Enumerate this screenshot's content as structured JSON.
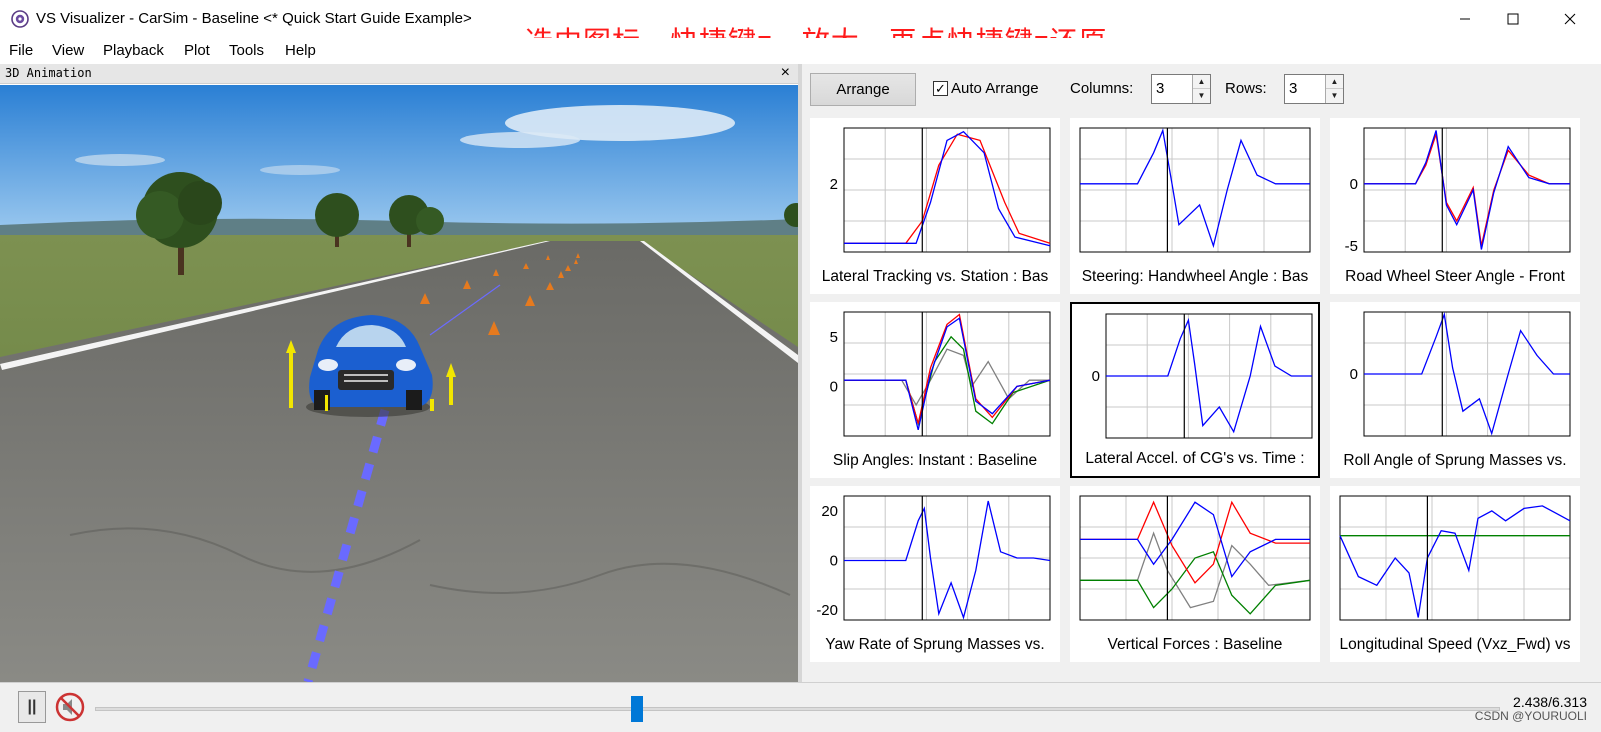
{
  "window": {
    "title": "VS Visualizer - CarSim - Baseline <* Quick Start Guide Example>",
    "annotation": "选中图标，快捷键z，放大，再点快捷键z还原"
  },
  "menu": [
    "File",
    "View",
    "Playback",
    "Plot",
    "Tools",
    "Help"
  ],
  "animation": {
    "title": "3D Animation"
  },
  "toolbar": {
    "arrange_label": "Arrange",
    "auto_arrange_label": "Auto Arrange",
    "auto_arrange_checked": true,
    "columns_label": "Columns:",
    "columns_value": "3",
    "rows_label": "Rows:",
    "rows_value": "3"
  },
  "plots": [
    {
      "title": "Lateral Tracking vs. Station : Bas",
      "yticks": [
        "2"
      ],
      "selected": false
    },
    {
      "title": "Steering: Handwheel Angle : Bas",
      "yticks": [],
      "selected": false
    },
    {
      "title": "Road Wheel Steer Angle - Front",
      "yticks": [
        "0",
        "-5"
      ],
      "selected": false
    },
    {
      "title": "Slip Angles: Instant : Baseline",
      "yticks": [
        "5",
        "0"
      ],
      "selected": false
    },
    {
      "title": "Lateral Accel. of CG's vs. Time :",
      "yticks": [
        "0"
      ],
      "selected": true
    },
    {
      "title": "Roll Angle of Sprung Masses vs.",
      "yticks": [
        "0"
      ],
      "selected": false
    },
    {
      "title": "Yaw Rate of Sprung Masses vs.",
      "yticks": [
        "20",
        "0",
        "-20"
      ],
      "selected": false
    },
    {
      "title": "Vertical Forces : Baseline",
      "yticks": [],
      "selected": false
    },
    {
      "title": "Longitudinal Speed (Vxz_Fwd) vs",
      "yticks": [],
      "selected": false
    }
  ],
  "playback": {
    "time_readout": "2.438/6.313",
    "progress_fraction": 0.386,
    "watermark": "CSDN @YOURUOLI"
  },
  "colors": {
    "trace_blue": "#0000ff",
    "trace_red": "#ff0000",
    "trace_green": "#008000",
    "trace_gray": "#808080",
    "accent": "#0078d7",
    "annotation_red": "#ff1a1a"
  }
}
